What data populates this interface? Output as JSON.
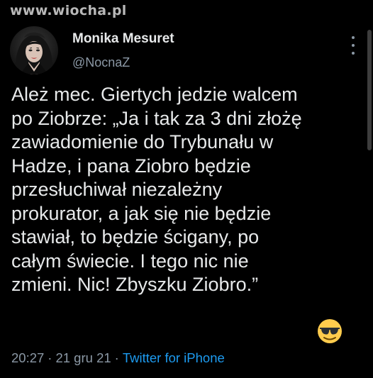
{
  "watermark": "www.wiocha.pl",
  "author": {
    "name": "Monika Mesuret",
    "handle": "@NocnaZ"
  },
  "tweet": {
    "text": "Ależ mec. Giertych jedzie walcem\npo Ziobrze: „Ja i tak za 3 dni złożę\nzawiadomienie do Trybunału w\nHadze, i pana Ziobro będzie\nprzesłuchiwał niezależny\nprokurator, a jak się nie będzie\nstawiał, to będzie ścigany, po\ncałym świecie. I tego nic nie\nzmieni. Nic! Zbyszku Ziobro.”",
    "emoji": "sunglasses-face"
  },
  "meta": {
    "time": "20:27",
    "date": "21 gru 21",
    "separator": "·",
    "source": "Twitter for iPhone"
  },
  "colors": {
    "background": "#000000",
    "text": "#e7e9ea",
    "secondary": "#8b98a5",
    "link": "#1d9bf0"
  }
}
